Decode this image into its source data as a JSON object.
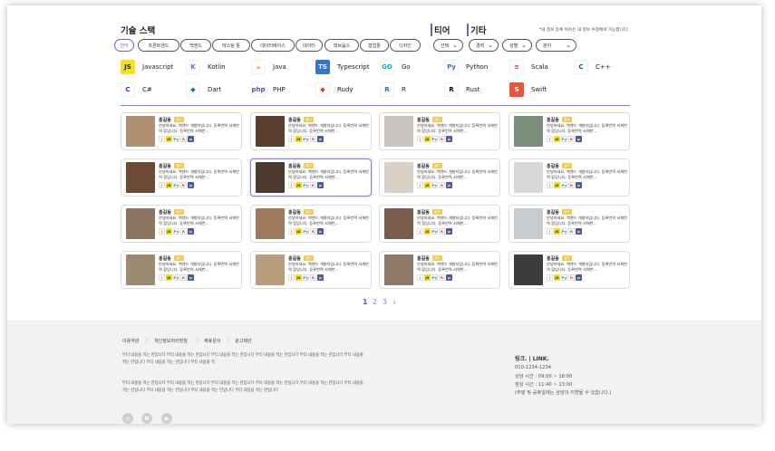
{
  "filters": {
    "tech_title": "기술 스택",
    "tier_title": "티어",
    "etc_title": "기타",
    "notice": "*내 정보 등록 뒤쓰는 내 정보 수정에서 가능합니다.",
    "categories": [
      "언어",
      "프론트엔드",
      "백엔드",
      "테스팅 툴",
      "데이터베이스",
      "데이터",
      "데브옵스",
      "협업툴",
      "디자인"
    ],
    "tier_select": "선택",
    "selects": [
      "경력",
      "성별",
      "분야"
    ]
  },
  "languages": [
    {
      "name": "Javascript",
      "icon": "JS",
      "bg": "#f7df1e",
      "fg": "#222"
    },
    {
      "name": "Kotlin",
      "icon": "K",
      "bg": "#ffffff",
      "fg": "#7f52ff"
    },
    {
      "name": "Java",
      "icon": "☕",
      "bg": "#ffffff",
      "fg": "#e76f00"
    },
    {
      "name": "Typescript",
      "icon": "TS",
      "bg": "#3178c6",
      "fg": "#fff"
    },
    {
      "name": "Go",
      "icon": "GO",
      "bg": "#ffffff",
      "fg": "#00add8"
    },
    {
      "name": "Python",
      "icon": "Py",
      "bg": "#ffffff",
      "fg": "#3776ab"
    },
    {
      "name": "Scala",
      "icon": "≡",
      "bg": "#ffffff",
      "fg": "#dc322f"
    },
    {
      "name": "C++",
      "icon": "C",
      "bg": "#ffffff",
      "fg": "#00599c"
    },
    {
      "name": "C#",
      "icon": "C",
      "bg": "#ffffff",
      "fg": "#68217a"
    },
    {
      "name": "Dart",
      "icon": "◆",
      "bg": "#ffffff",
      "fg": "#0175c2"
    },
    {
      "name": "PHP",
      "icon": "php",
      "bg": "#ffffff",
      "fg": "#4f5b93"
    },
    {
      "name": "Rudy",
      "icon": "◆",
      "bg": "#ffffff",
      "fg": "#cc342d"
    },
    {
      "name": "R",
      "icon": "R",
      "bg": "#ffffff",
      "fg": "#276dc3"
    },
    {
      "name": "Rust",
      "icon": "R",
      "bg": "#ffffff",
      "fg": "#000"
    },
    {
      "name": "Swift",
      "icon": "S",
      "bg": "#f05138",
      "fg": "#fff"
    }
  ],
  "card": {
    "name": "홍길동",
    "tier": "골드",
    "desc": "안녕하세요. 백엔드 개발자입니다. 등록번역 서체번역 합입니다. 등록번역 서체번...",
    "skills": [
      {
        "icon": "J",
        "bg": "#ffffff",
        "fg": "#e76f00"
      },
      {
        "icon": "JS",
        "bg": "#f7df1e",
        "fg": "#222"
      },
      {
        "icon": "Py",
        "bg": "#ffffff",
        "fg": "#3776ab"
      },
      {
        "icon": "R",
        "bg": "#ffffff",
        "fg": "#cc342d"
      },
      {
        "icon": "p",
        "bg": "#4f5b93",
        "fg": "#fff"
      }
    ]
  },
  "photos": [
    "#b08f72",
    "#5b3f2e",
    "#c9c4bf",
    "#7c8f7a",
    "#6b4b36",
    "#4c3a2e",
    "#d9cfc4",
    "#d8d8d8",
    "#8a7660",
    "#a07a5c",
    "#7a5d4a",
    "#c7ccd0",
    "#9c8a73",
    "#b89e7a",
    "#8e7868",
    "#3c3c3c"
  ],
  "pager": {
    "pages": [
      "1",
      "2",
      "3"
    ],
    "next": "›"
  },
  "footer": {
    "links": [
      "이용약관",
      "개인정보처리방침",
      "제휴문의",
      "광고제안"
    ],
    "para1": "무티 내용을 적는 란입니다 무티 내용을 적는 란입니다 무티 내용을 적는 란입니다 무티 내용을 적는 란입니다 무티 내용을 적는 란입니다 무티 내용을 적는 란입니다 무티 내용을 적는 란입니다 무티 내용을 적",
    "para2": "무티 내용을 적는 란입니다 무티 내용을 적는 란입니다 무티 내용을 적는 란입니다 무티 내용을 적는 란입니다 무티 내용을 적는 란입니다 무티 내용을 적는 란입니다 무티 내용을 적는 란입니다 무티 내용을 적는 란입니다 무티 내용을 적는 란입니다",
    "brand": "링크. | LINK.",
    "phone": "010-1234-1234",
    "hours1": "상담 시간 : 09:00 ~ 18:00",
    "hours2": "점심 시간 : 11:40 ~ 13:00",
    "hours3": "(주말 및 공휴일에는 상담이 지연될 수 있습니다.)",
    "social": [
      "instagram-icon",
      "naver-icon",
      "youtube-icon"
    ]
  },
  "colors": {
    "accent": "#6b5bd6",
    "tier": "#f2c94c"
  }
}
